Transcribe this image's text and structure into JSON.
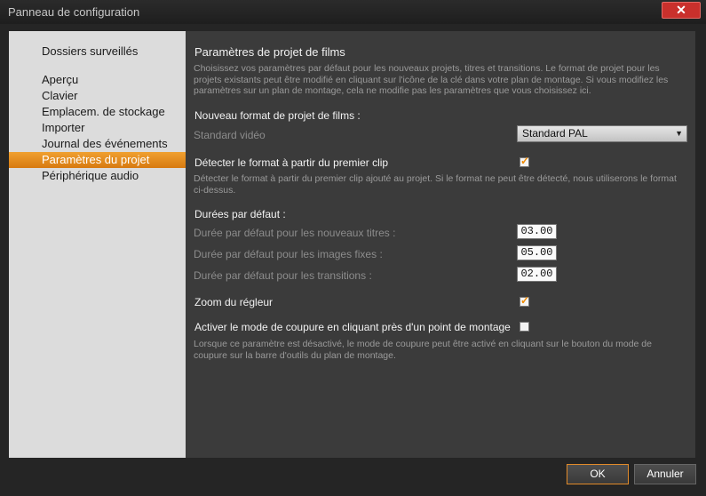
{
  "window": {
    "title": "Panneau de configuration",
    "close_label": "✕"
  },
  "sidebar": {
    "items": [
      {
        "label": "Dossiers surveillés"
      },
      {
        "label": "Aperçu"
      },
      {
        "label": "Clavier"
      },
      {
        "label": "Emplacem. de stockage"
      },
      {
        "label": "Importer"
      },
      {
        "label": "Journal des événements"
      },
      {
        "label": "Paramètres du projet",
        "active": true
      },
      {
        "label": "Périphérique audio"
      }
    ]
  },
  "content": {
    "title": "Paramètres de projet de films",
    "intro": "Choisissez vos paramètres par défaut pour les nouveaux projets, titres et transitions. Le format de projet pour les projets existants peut être modifié en cliquant sur l'icône de la clé dans votre plan de montage. Si vous modifiez les paramètres sur un plan de montage, cela ne modifie pas les paramètres que vous choisissez ici.",
    "new_format_heading": "Nouveau format de projet de films :",
    "video_standard_label": "Standard vidéo",
    "video_standard_value": "Standard PAL",
    "detect_format_label": "Détecter le format à partir du premier clip",
    "detect_format_checked": true,
    "detect_format_desc": "Détecter le format à partir du premier clip ajouté au projet. Si le format ne peut être détecté, nous utiliserons le format ci-dessus.",
    "durations_heading": "Durées par défaut :",
    "durations": [
      {
        "label": "Durée par défaut pour les nouveaux titres :",
        "value": "03.00"
      },
      {
        "label": "Durée par défaut pour les images fixes :",
        "value": "05.00"
      },
      {
        "label": "Durée par défaut pour les transitions :",
        "value": "02.00"
      }
    ],
    "zoom_label": "Zoom du régleur",
    "zoom_checked": true,
    "cut_mode_label": "Activer le mode de coupure en cliquant près d'un point de montage",
    "cut_mode_checked": false,
    "cut_mode_desc": "Lorsque ce paramètre est désactivé, le mode de coupure peut être activé en cliquant sur le bouton du mode de coupure sur la barre d'outils du plan de montage."
  },
  "footer": {
    "ok_label": "OK",
    "cancel_label": "Annuler"
  },
  "colors": {
    "accent": "#e18a2a",
    "close_red": "#c9302c",
    "sidebar_bg": "#dcdcdc",
    "content_bg": "#3b3b3b"
  }
}
